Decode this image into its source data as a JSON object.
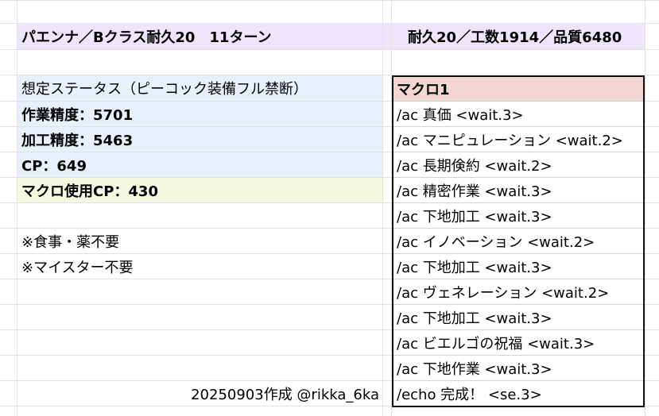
{
  "title_row": {
    "left": "パエンナ／Bクラス耐久20　11ターン",
    "right": "耐久20／工数1914／品質6480"
  },
  "status": {
    "heading": "想定ステータス（ピーコック装備フル禁断）",
    "craftsmanship": "作業精度：5701",
    "control": "加工精度：5463",
    "cp": "CP：649",
    "macro_cp": "マクロ使用CP：430"
  },
  "notes": {
    "food": "※食事・薬不要",
    "meister": "※マイスター不要"
  },
  "credit": "20250903作成 @rikka_6ka",
  "macro": {
    "heading": "マクロ1",
    "lines": [
      "/ac 真価 <wait.3>",
      "/ac マニピュレーション <wait.2>",
      "/ac 長期倹約 <wait.2>",
      "/ac 精密作業 <wait.3>",
      "/ac 下地加工 <wait.3>",
      "/ac イノベーション <wait.2>",
      "/ac 下地加工 <wait.3>",
      "/ac ヴェネレーション <wait.2>",
      "/ac 下地加工 <wait.3>",
      "/ac ビエルゴの祝福 <wait.3>",
      "/ac 下地作業 <wait.3>",
      "/echo 完成！ <se.3>"
    ]
  },
  "colors": {
    "title_bg": "#ede6fb",
    "status_bg": "#e8f1fb",
    "macro_cp_bg": "#f4fadf",
    "macro_heading_bg": "#f4d7d4"
  }
}
